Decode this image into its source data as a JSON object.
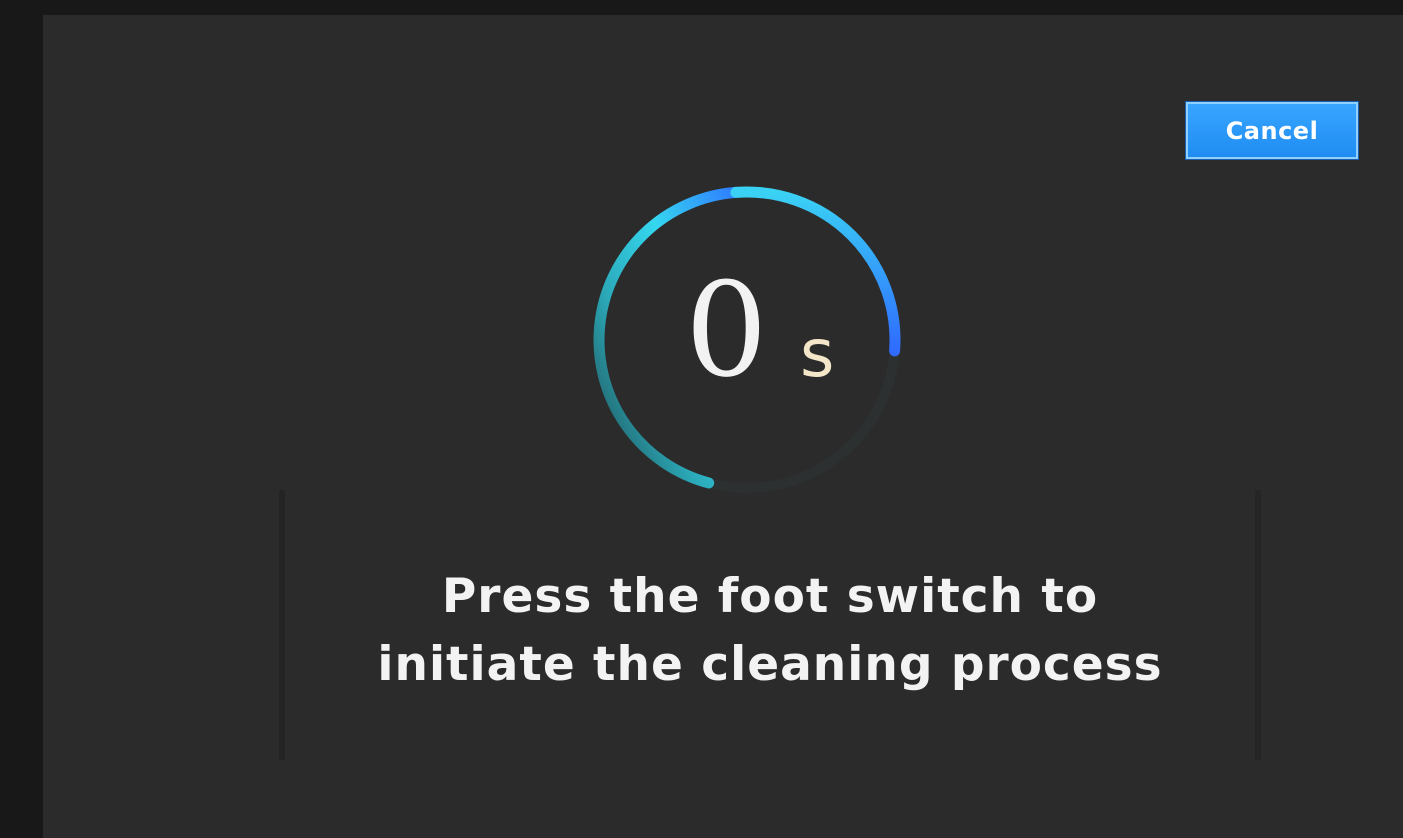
{
  "dialog": {
    "cancel_label": "Cancel",
    "countdown": {
      "value": "0",
      "unit": "s",
      "progress": 0.72
    },
    "message_line1": "Press the foot switch to",
    "message_line2": "initiate the cleaning process"
  },
  "colors": {
    "screen_background": "#2b2b2b",
    "frame_background": "#181818",
    "accent_blue": "#1f8cf2",
    "ring_cyan": "#35d7f0",
    "ring_blue": "#2f7dff",
    "unit_color": "#f4e6c8"
  }
}
